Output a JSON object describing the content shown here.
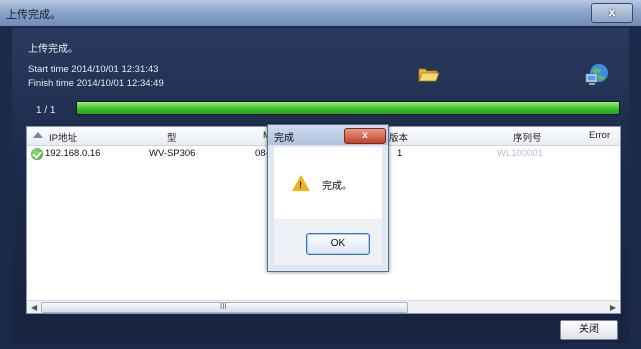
{
  "window": {
    "title": "上传完成。",
    "close_label": "x"
  },
  "status": {
    "message": "上传完成。",
    "start": "Start time 2014/10/01 12:31:43",
    "finish": "Finish time 2014/10/01 12:34:49"
  },
  "progress": {
    "label": "1 / 1",
    "fraction": 1.0,
    "color": "#3cc22a"
  },
  "icons": {
    "folder": "folder-open-icon",
    "network": "network-computer-icon"
  },
  "list": {
    "columns": [
      "IP地址",
      "型",
      "M",
      "版本",
      "序列号",
      "Error"
    ],
    "rows": [
      {
        "status_icon": "check-icon",
        "ip": "192.168.0.16",
        "model": "WV-SP306",
        "mac": "08-00-",
        "version": "1",
        "serial": "WL100001"
      }
    ],
    "scroll_grip": "III"
  },
  "footer": {
    "close_button": "关闭"
  },
  "dialog": {
    "title": "完成",
    "close_label": "x",
    "icon": "warning-icon",
    "message": "完成。",
    "ok_button": "OK"
  }
}
